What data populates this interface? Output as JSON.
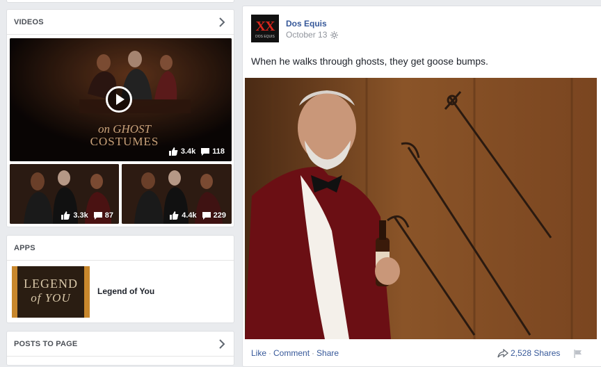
{
  "sidebar": {
    "videos": {
      "title": "VIDEOS",
      "main": {
        "overlay_line1": "on GHOST",
        "overlay_line2": "COSTUMES",
        "likes": "3.4k",
        "comments": "118"
      },
      "small": [
        {
          "likes": "3.3k",
          "comments": "87"
        },
        {
          "likes": "4.4k",
          "comments": "229"
        }
      ]
    },
    "apps": {
      "title": "APPS",
      "item": {
        "name": "Legend of You",
        "thumb_line1": "LEGEND",
        "thumb_line2": "of YOU"
      }
    },
    "posts_to_page": {
      "title": "POSTS TO PAGE"
    }
  },
  "post": {
    "page_name": "Dos Equis",
    "logo_text": "XX",
    "logo_sub": "DOS EQUIS",
    "date": "October 13",
    "text": "When he walks through ghosts, they get goose bumps.",
    "actions": {
      "like": "Like",
      "comment": "Comment",
      "share": "Share",
      "separator": "·"
    },
    "shares": "2,528 Shares"
  },
  "icons": {
    "chevron": "chevron-right-icon",
    "play": "play-icon",
    "like": "thumbs-up-icon",
    "comment": "comment-icon",
    "globe": "gear-icon",
    "share": "share-arrow-icon",
    "flag": "flag-icon"
  },
  "colors": {
    "link": "#365899",
    "background": "#e9ebee",
    "logo_red": "#d9261c"
  }
}
